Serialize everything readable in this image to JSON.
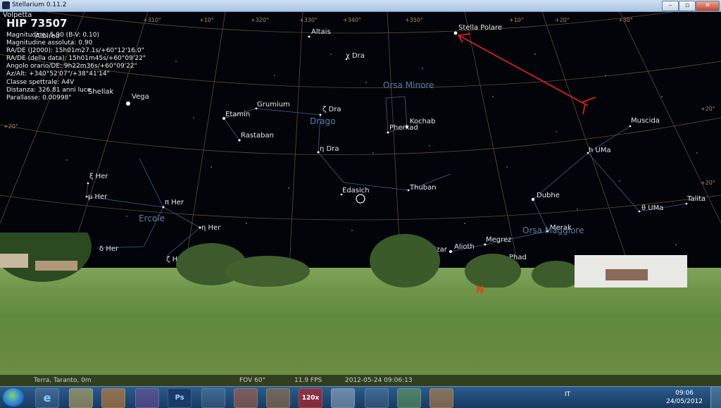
{
  "window": {
    "title": "Stellarium 0.11.2",
    "min": "–",
    "max": "▫",
    "close": "✕"
  },
  "info": {
    "name": "HIP 73507",
    "lines": [
      "Magnitudine: 5.90 (B-V: 0.10)",
      "Magnitudine assoluta: 0.90",
      "RA/DE (J2000): 15h01m27.1s/+60°12'16.0\"",
      "RA/DE (della data): 15h01m45s/+60°09'22\"",
      "Angolo orario/DE: 9h22m36s/+60°09'22\"",
      "Az/Alt: +340°52'07\"/+38°41'14\"",
      "Classe spettrale: A4V",
      "Distanza: 326.81 anni luce",
      "Parallasse: 0.00998\""
    ]
  },
  "stars": {
    "volpetta": "Volpetta",
    "albireo": "Albireo",
    "altais": "Altais",
    "chi_dra": "χ Dra",
    "stella_polare": "Stella Polare",
    "shellak": "Shellak",
    "vega": "Vega",
    "grumium": "Grumium",
    "zeta_dra": "ζ Dra",
    "etamin": "Etamin",
    "kochab": "Kochab",
    "pherkad": "Pherkad",
    "muscida": "Muscida",
    "rastaban": "Rastaban",
    "eta_dra": "η Dra",
    "h_uma": "h UMa",
    "xi_her": "ξ Her",
    "mu_her": "μ Her",
    "edasich": "Edasich",
    "thuban": "Thuban",
    "dubhe": "Dubhe",
    "talita": "Talita",
    "pi_her": "π Her",
    "theta_uma": "θ UMa",
    "eta_her": "η Her",
    "merak": "Merak",
    "alioth": "Alioth",
    "megrez": "Megrez",
    "mizar": "Mizar",
    "delta_her": "δ Her",
    "zeta_her": "ζ He",
    "phad": "Phad"
  },
  "constellations": {
    "orsa_minore": "Orsa Minore",
    "drago": "Drago",
    "ercole": "Ercole",
    "orsa_maggiore": "Orsa Maggiore"
  },
  "grid_labels": [
    "+310°",
    "+320°",
    "+330°",
    "+340°",
    "+350°",
    "+10°",
    "+20°",
    "+30°",
    "+10°",
    "+20°",
    "+20°",
    "+20°"
  ],
  "cardinal": "N",
  "status": {
    "location": "Terra, Taranto, 0m",
    "fov": "FOV 60°",
    "fps": "11.9 FPS",
    "datetime": "2012-05-24   09:06:13"
  },
  "taskbar": {
    "apps": [
      "e",
      "",
      "",
      "",
      "Ps",
      "",
      "",
      "",
      "120x",
      "",
      "",
      "",
      "",
      ""
    ],
    "lang": "IT",
    "clock_time": "09:06",
    "clock_date": "24/05/2012"
  },
  "colors": {
    "annotation": "#d82020",
    "grid": "#8a6a44"
  }
}
